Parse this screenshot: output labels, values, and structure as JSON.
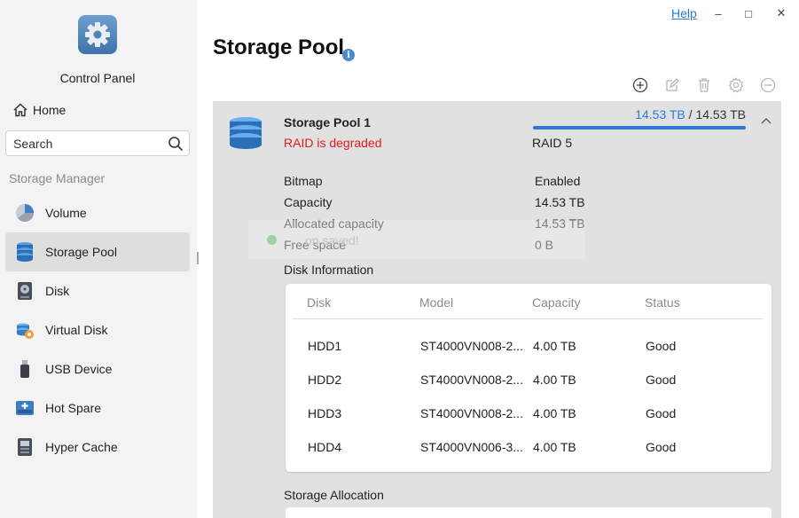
{
  "window": {
    "help_label": "Help",
    "minimize": "–",
    "maximize": "□",
    "close": "✕"
  },
  "sidebar": {
    "app_title": "Control Panel",
    "home_label": "Home",
    "search_placeholder": "Search",
    "section_label": "Storage Manager",
    "items": [
      {
        "label": "Volume",
        "icon": "volume-icon"
      },
      {
        "label": "Storage Pool",
        "icon": "storage-pool-icon",
        "active": true
      },
      {
        "label": "Disk",
        "icon": "disk-icon"
      },
      {
        "label": "Virtual Disk",
        "icon": "virtual-disk-icon"
      },
      {
        "label": "USB Device",
        "icon": "usb-device-icon"
      },
      {
        "label": "Hot Spare",
        "icon": "hot-spare-icon"
      },
      {
        "label": "Hyper Cache",
        "icon": "hyper-cache-icon"
      }
    ]
  },
  "main": {
    "title": "Storage Pool",
    "toolbar": [
      "add-icon",
      "edit-icon",
      "delete-icon",
      "settings-icon",
      "remove-icon"
    ],
    "pool": {
      "name": "Storage Pool 1",
      "status": "RAID is degraded",
      "used": "14.53 TB",
      "separator": "/",
      "total": "14.53 TB",
      "usage_fraction": 1.0,
      "raid_type": "RAID 5",
      "properties": [
        {
          "key": "Bitmap",
          "value": "Enabled"
        },
        {
          "key": "Capacity",
          "value": "14.53 TB"
        },
        {
          "key": "Allocated capacity",
          "value": "14.53 TB"
        },
        {
          "key": "Free space",
          "value": "0 B"
        }
      ],
      "toast": "on saved!",
      "disk_info_title": "Disk Information",
      "disk_columns": [
        "Disk",
        "Model",
        "Capacity",
        "Status"
      ],
      "disks": [
        [
          "HDD1",
          "ST4000VN008-2...",
          "4.00 TB",
          "Good"
        ],
        [
          "HDD2",
          "ST4000VN008-2...",
          "4.00 TB",
          "Good"
        ],
        [
          "HDD3",
          "ST4000VN008-2...",
          "4.00 TB",
          "Good"
        ],
        [
          "HDD4",
          "ST4000VN006-3...",
          "4.00 TB",
          "Good"
        ]
      ],
      "allocation_title": "Storage Allocation"
    }
  },
  "colors": {
    "accent": "#2a7ad4",
    "error": "#e0191f",
    "card_bg": "#e1e1e1",
    "sidebar_bg": "#f3f3f3"
  }
}
